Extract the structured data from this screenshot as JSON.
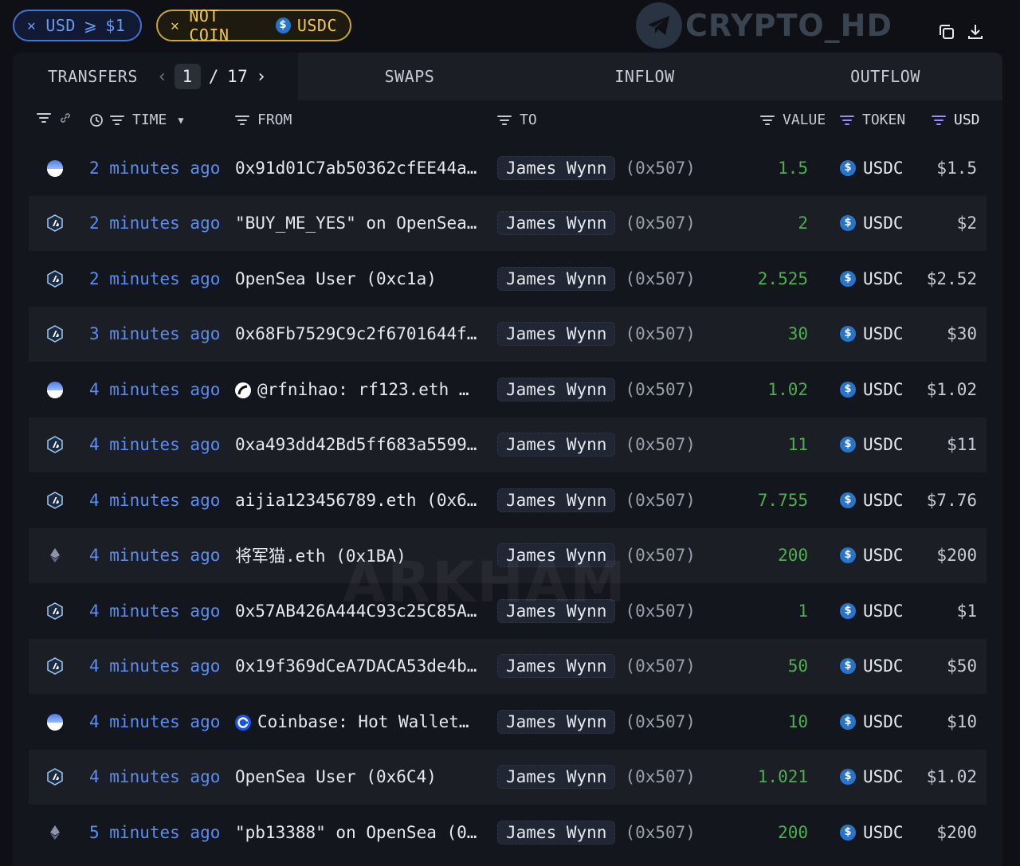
{
  "filters": {
    "usd_chip": {
      "label": "USD",
      "op": "⩾",
      "value": "$1"
    },
    "coin_chip": {
      "prefix": "NOT COIN",
      "token": "USDC"
    }
  },
  "watermark": {
    "brand": "CRYPTO_HD",
    "overlay": "ARKHAM"
  },
  "tabs": {
    "transfers": "TRANSFERS",
    "swaps": "SWAPS",
    "inflow": "INFLOW",
    "outflow": "OUTFLOW",
    "page_current": "1",
    "page_total": "17"
  },
  "columns": {
    "time": "TIME",
    "from": "FROM",
    "to": "TO",
    "value": "VALUE",
    "token": "TOKEN",
    "usd": "USD"
  },
  "colors": {
    "accent_blue": "#5b8df2",
    "value_green": "#4caf50",
    "filter_purple": "#9b8cff",
    "usdc_blue": "#2775ca"
  },
  "rows": [
    {
      "chain": "base-icon",
      "time": "2 minutes ago",
      "from": "0x91d01C7ab50362cfEE44a…",
      "from_icon": "",
      "to_name": "James Wynn",
      "to_addr": "(0x507)",
      "value": "1.5",
      "token": "USDC",
      "usd": "$1.5"
    },
    {
      "chain": "arbitrum-icon",
      "time": "2 minutes ago",
      "from": "\"BUY_ME_YES\" on OpenSea…",
      "from_icon": "",
      "to_name": "James Wynn",
      "to_addr": "(0x507)",
      "value": "2",
      "token": "USDC",
      "usd": "$2"
    },
    {
      "chain": "arbitrum-icon",
      "time": "2 minutes ago",
      "from": "OpenSea User (0xc1a)",
      "from_icon": "",
      "to_name": "James Wynn",
      "to_addr": "(0x507)",
      "value": "2.525",
      "token": "USDC",
      "usd": "$2.52"
    },
    {
      "chain": "arbitrum-icon",
      "time": "3 minutes ago",
      "from": "0x68Fb7529C9c2f6701644f…",
      "from_icon": "",
      "to_name": "James Wynn",
      "to_addr": "(0x507)",
      "value": "30",
      "token": "USDC",
      "usd": "$30"
    },
    {
      "chain": "base-icon",
      "time": "4 minutes ago",
      "from": "@rfnihao: rf123.eth (…",
      "from_icon": "rainbow-icon",
      "to_name": "James Wynn",
      "to_addr": "(0x507)",
      "value": "1.02",
      "token": "USDC",
      "usd": "$1.02"
    },
    {
      "chain": "arbitrum-icon",
      "time": "4 minutes ago",
      "from": "0xa493dd42Bd5ff683a5599…",
      "from_icon": "",
      "to_name": "James Wynn",
      "to_addr": "(0x507)",
      "value": "11",
      "token": "USDC",
      "usd": "$11"
    },
    {
      "chain": "arbitrum-icon",
      "time": "4 minutes ago",
      "from": "aijia123456789.eth (0x6…",
      "from_icon": "",
      "to_name": "James Wynn",
      "to_addr": "(0x507)",
      "value": "7.755",
      "token": "USDC",
      "usd": "$7.76"
    },
    {
      "chain": "ethereum-icon",
      "time": "4 minutes ago",
      "from": "将军猫.eth (0x1BA)",
      "from_icon": "",
      "to_name": "James Wynn",
      "to_addr": "(0x507)",
      "value": "200",
      "token": "USDC",
      "usd": "$200"
    },
    {
      "chain": "arbitrum-icon",
      "time": "4 minutes ago",
      "from": "0x57AB426A444C93c25C85A…",
      "from_icon": "",
      "to_name": "James Wynn",
      "to_addr": "(0x507)",
      "value": "1",
      "token": "USDC",
      "usd": "$1"
    },
    {
      "chain": "arbitrum-icon",
      "time": "4 minutes ago",
      "from": "0x19f369dCeA7DACA53de4b…",
      "from_icon": "",
      "to_name": "James Wynn",
      "to_addr": "(0x507)",
      "value": "50",
      "token": "USDC",
      "usd": "$50"
    },
    {
      "chain": "base-icon",
      "time": "4 minutes ago",
      "from": "Coinbase: Hot Wallet …",
      "from_icon": "coinbase-icon",
      "to_name": "James Wynn",
      "to_addr": "(0x507)",
      "value": "10",
      "token": "USDC",
      "usd": "$10"
    },
    {
      "chain": "arbitrum-icon",
      "time": "4 minutes ago",
      "from": "OpenSea User (0x6C4)",
      "from_icon": "",
      "to_name": "James Wynn",
      "to_addr": "(0x507)",
      "value": "1.021",
      "token": "USDC",
      "usd": "$1.02"
    },
    {
      "chain": "ethereum-icon",
      "time": "5 minutes ago",
      "from": "\"pb13388\" on OpenSea (0…",
      "from_icon": "",
      "to_name": "James Wynn",
      "to_addr": "(0x507)",
      "value": "200",
      "token": "USDC",
      "usd": "$200"
    }
  ]
}
